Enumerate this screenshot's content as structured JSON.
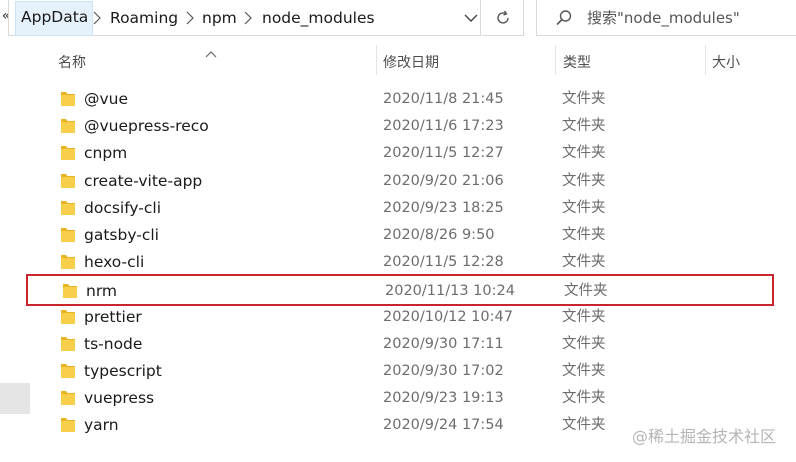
{
  "address_bar": {
    "overflow_glyph": "«",
    "crumbs": [
      "AppData",
      "Roaming",
      "npm",
      "node_modules"
    ],
    "search_placeholder": "搜索\"node_modules\""
  },
  "columns": {
    "name": "名称",
    "date_modified": "修改日期",
    "type": "类型",
    "size": "大小"
  },
  "files": [
    {
      "name": "@vue",
      "date": "2020/11/8 21:45",
      "type": "文件夹"
    },
    {
      "name": "@vuepress-reco",
      "date": "2020/11/6 17:23",
      "type": "文件夹"
    },
    {
      "name": "cnpm",
      "date": "2020/11/5 12:27",
      "type": "文件夹"
    },
    {
      "name": "create-vite-app",
      "date": "2020/9/20 21:06",
      "type": "文件夹"
    },
    {
      "name": "docsify-cli",
      "date": "2020/9/23 18:25",
      "type": "文件夹"
    },
    {
      "name": "gatsby-cli",
      "date": "2020/8/26 9:50",
      "type": "文件夹"
    },
    {
      "name": "hexo-cli",
      "date": "2020/11/5 12:28",
      "type": "文件夹"
    },
    {
      "name": "nrm",
      "date": "2020/11/13 10:24",
      "type": "文件夹"
    },
    {
      "name": "prettier",
      "date": "2020/10/12 10:47",
      "type": "文件夹"
    },
    {
      "name": "ts-node",
      "date": "2020/9/30 17:11",
      "type": "文件夹"
    },
    {
      "name": "typescript",
      "date": "2020/9/30 17:02",
      "type": "文件夹"
    },
    {
      "name": "vuepress",
      "date": "2020/9/23 19:13",
      "type": "文件夹"
    },
    {
      "name": "yarn",
      "date": "2020/9/24 17:54",
      "type": "文件夹"
    }
  ],
  "watermark": "@稀土掘金技术社区",
  "colors": {
    "folder": "#f4c430",
    "highlight_border": "#c9252c",
    "active_crumb_bg": "#e5f1fb"
  }
}
